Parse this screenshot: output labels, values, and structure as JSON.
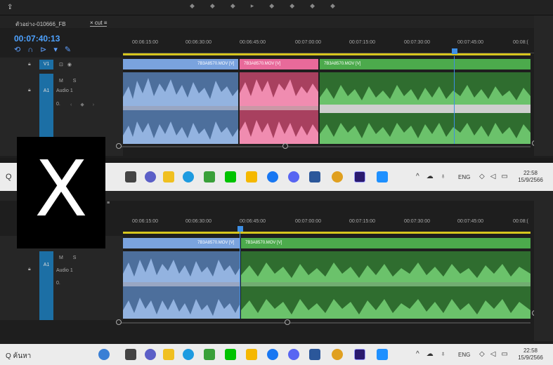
{
  "top_panel": {
    "sequence_name": "ตัวอย่าง-010666_FB",
    "tab_label": "× cut ≡",
    "timecode": "00:07:40:13",
    "ruler_ticks": [
      "00:06:15:00",
      "00:06:30:00",
      "00:06:45:00",
      "00:07:00:00",
      "00:07:15:00",
      "00:07:30:00",
      "00:07:45:00",
      "00:08:("
    ],
    "video_track": {
      "label": "V1"
    },
    "audio_track": {
      "label": "A1",
      "name": "Audio 1",
      "controls": "M S",
      "volume": "0."
    },
    "clips": [
      {
        "label": "7B3A8570.MOV [V]",
        "color": "#7aa3de"
      },
      {
        "label": "7B3A8570.MOV [V]",
        "color": "#e86a9a"
      },
      {
        "label": "7B3A8570.MOV [V]",
        "color": "#4caa4c"
      }
    ]
  },
  "bottom_panel": {
    "ruler_ticks": [
      "00:06:15:00",
      "00:06:30:00",
      "00:06:45:00",
      "00:07:00:00",
      "00:07:15:00",
      "00:07:30:00",
      "00:07:45:00",
      "00:08:("
    ],
    "audio_track": {
      "label": "A1",
      "name": "Audio 1",
      "controls": "M S",
      "volume": "0."
    },
    "clips": [
      {
        "label": "7B3A8570.MOV [V]",
        "color": "#7aa3de"
      },
      {
        "label": "7B3A8570.MOV [V]",
        "color": "#4caa4c"
      }
    ]
  },
  "overlay": {
    "letter": "X"
  },
  "taskbar_top": {
    "search_glyph": "Q",
    "lang": "ENG",
    "time": "22:58",
    "date": "15/9/2566"
  },
  "taskbar_bottom": {
    "search_text": "Q ค้นหา",
    "lang": "ENG",
    "time": "22:58",
    "date": "15/9/2566"
  },
  "colors": {
    "accent": "#4ea2ff",
    "timeline_yellow": "#d6c51d",
    "audio_blue": "#6e92c8",
    "audio_pink": "#d85c8c",
    "audio_green": "#3b8a3b"
  }
}
